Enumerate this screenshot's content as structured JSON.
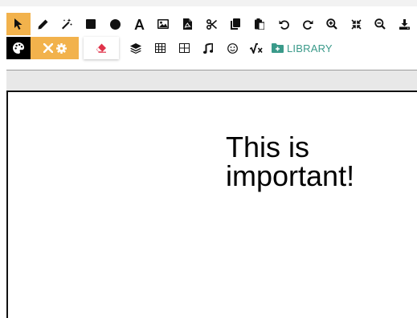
{
  "toolbar": {
    "row1": [
      {
        "icon": "pointer-icon",
        "active": true
      },
      {
        "icon": "pencil-icon"
      },
      {
        "icon": "magic-wand-icon"
      },
      {
        "icon": "square-icon"
      },
      {
        "icon": "circle-icon"
      },
      {
        "icon": "text-icon",
        "glyph": "A"
      },
      {
        "icon": "image-icon"
      },
      {
        "icon": "pdf-icon"
      },
      {
        "icon": "scissors-icon"
      },
      {
        "icon": "copy-icon"
      },
      {
        "icon": "paste-icon"
      },
      {
        "icon": "undo-icon"
      },
      {
        "icon": "redo-icon"
      },
      {
        "icon": "zoom-in-icon"
      },
      {
        "icon": "compress-icon"
      },
      {
        "icon": "zoom-out-icon"
      },
      {
        "icon": "download-icon"
      }
    ],
    "row2": {
      "palette_icon": "palette-icon",
      "color_icons": [
        "close-icon",
        "gear-icon"
      ],
      "eraser_icon": "eraser-icon",
      "tools": [
        {
          "icon": "layers-icon"
        },
        {
          "icon": "table-icon"
        },
        {
          "icon": "grid-icon"
        },
        {
          "icon": "music-icon"
        },
        {
          "icon": "smiley-icon"
        },
        {
          "icon": "square-root-icon"
        }
      ],
      "library_icon": "folder-plus-icon",
      "library_label": "LIBRARY"
    }
  },
  "canvas": {
    "text": "This is\nimportant!"
  },
  "colors": {
    "accent": "#f2b24c",
    "library": "#3a9a8a",
    "eraser": "#e0334a"
  }
}
